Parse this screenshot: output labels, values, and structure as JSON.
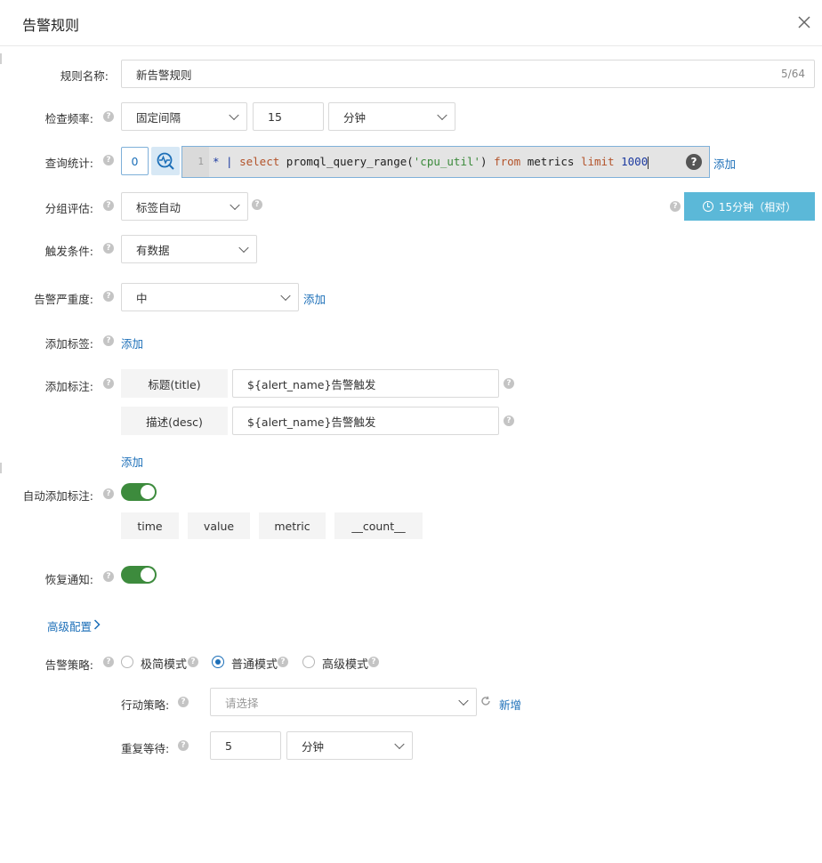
{
  "dialog": {
    "title": "告警规则"
  },
  "rule_name": {
    "label": "规则名称:",
    "value": "新告警规则",
    "counter": "5/64"
  },
  "check_freq": {
    "label": "检查频率:",
    "mode": "固定间隔",
    "interval": "15",
    "unit": "分钟"
  },
  "query": {
    "label": "查询统计:",
    "index": "0",
    "line_no": "1",
    "code": {
      "star": "* | ",
      "select": "select",
      "fn": " promql_query_range(",
      "arg": "'cpu_util'",
      "close": ") ",
      "from": "from",
      "table": " metrics ",
      "limit": "limit",
      "num": " 1000"
    },
    "add": "添加"
  },
  "time_range": {
    "label": "15分钟（相对）"
  },
  "group_eval": {
    "label": "分组评估:",
    "value": "标签自动"
  },
  "trigger": {
    "label": "触发条件:",
    "value": "有数据"
  },
  "severity": {
    "label": "告警严重度:",
    "value": "中",
    "add": "添加"
  },
  "labels": {
    "label": "添加标签:",
    "add": "添加"
  },
  "annotations": {
    "label": "添加标注:",
    "items": [
      {
        "key": "标题(title)",
        "value": "${alert_name}告警触发"
      },
      {
        "key": "描述(desc)",
        "value": "${alert_name}告警触发"
      }
    ],
    "add": "添加"
  },
  "auto_annotations": {
    "label": "自动添加标注:",
    "enabled": true,
    "tags": [
      "time",
      "value",
      "metric",
      "__count__"
    ]
  },
  "recovery": {
    "label": "恢复通知:",
    "enabled": true
  },
  "advanced": {
    "label": "高级配置"
  },
  "policy": {
    "label": "告警策略:",
    "options": [
      "极简模式",
      "普通模式",
      "高级模式"
    ],
    "selected": "普通模式",
    "action": {
      "label": "行动策略:",
      "placeholder": "请选择",
      "add": "新增"
    },
    "repeat": {
      "label": "重复等待:",
      "value": "5",
      "unit": "分钟"
    }
  },
  "colors": {
    "accent": "#1c6fb8",
    "toggle_on": "#3d8b3d",
    "time_button": "#5bb8d8",
    "editor_bg": "#e4e4e4"
  }
}
